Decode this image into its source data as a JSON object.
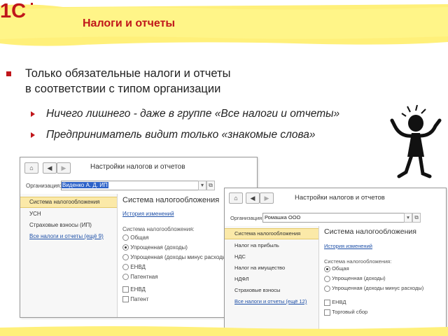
{
  "header": {
    "logo_text": "1С",
    "title": "Налоги и отчеты"
  },
  "main_bullet": {
    "line1": "Только обязательные налоги и отчеты",
    "line2": "в соответствии с типом организации"
  },
  "sub_bullets": [
    "Ничего лишнего - даже в группе «Все налоги и отчеты»",
    "Предприниматель видит только «знакомые слова»"
  ],
  "window1": {
    "home_icon": "home-icon",
    "title": "Настройки налогов и отчетов",
    "org_label": "Организация:",
    "org_value": "Виденко А. Д. ИП",
    "nav_items": [
      "Система налогообложения",
      "УСН",
      "Страховые взносы (ИП)",
      "Все налоги и отчеты (ещё 9)"
    ],
    "content_title": "Система налогообложения",
    "history_link": "История изменений",
    "tax_label": "Система налогообложения:",
    "radios": [
      "Общая",
      "Упрощенная (доходы)",
      "Упрощенная (доходы минус расходы)",
      "ЕНВД",
      "Патентная"
    ],
    "selected_radio": 1,
    "checks": [
      "ЕНВД",
      "Патент"
    ]
  },
  "window2": {
    "title": "Настройки налогов и отчетов",
    "org_label": "Организация:",
    "org_value": "Ромашка ООО",
    "nav_items": [
      "Система налогообложения",
      "Налог на прибыль",
      "НДС",
      "Налог на имущество",
      "НДФЛ",
      "Страховые взносы",
      "Все налоги и отчеты (ещё 12)"
    ],
    "content_title": "Система налогообложения",
    "history_link": "История изменений",
    "tax_label": "Система налогообложения:",
    "radios": [
      "Общая",
      "Упрощенная (доходы)",
      "Упрощенная (доходы минус расходы)"
    ],
    "selected_radio": 0,
    "checks": [
      "ЕНВД",
      "Торговый сбор"
    ]
  },
  "colors": {
    "accent_red": "#c0161b",
    "banner_yellow": "#fff07a",
    "active_nav": "#fbe9a8",
    "link": "#1d4fa7"
  }
}
